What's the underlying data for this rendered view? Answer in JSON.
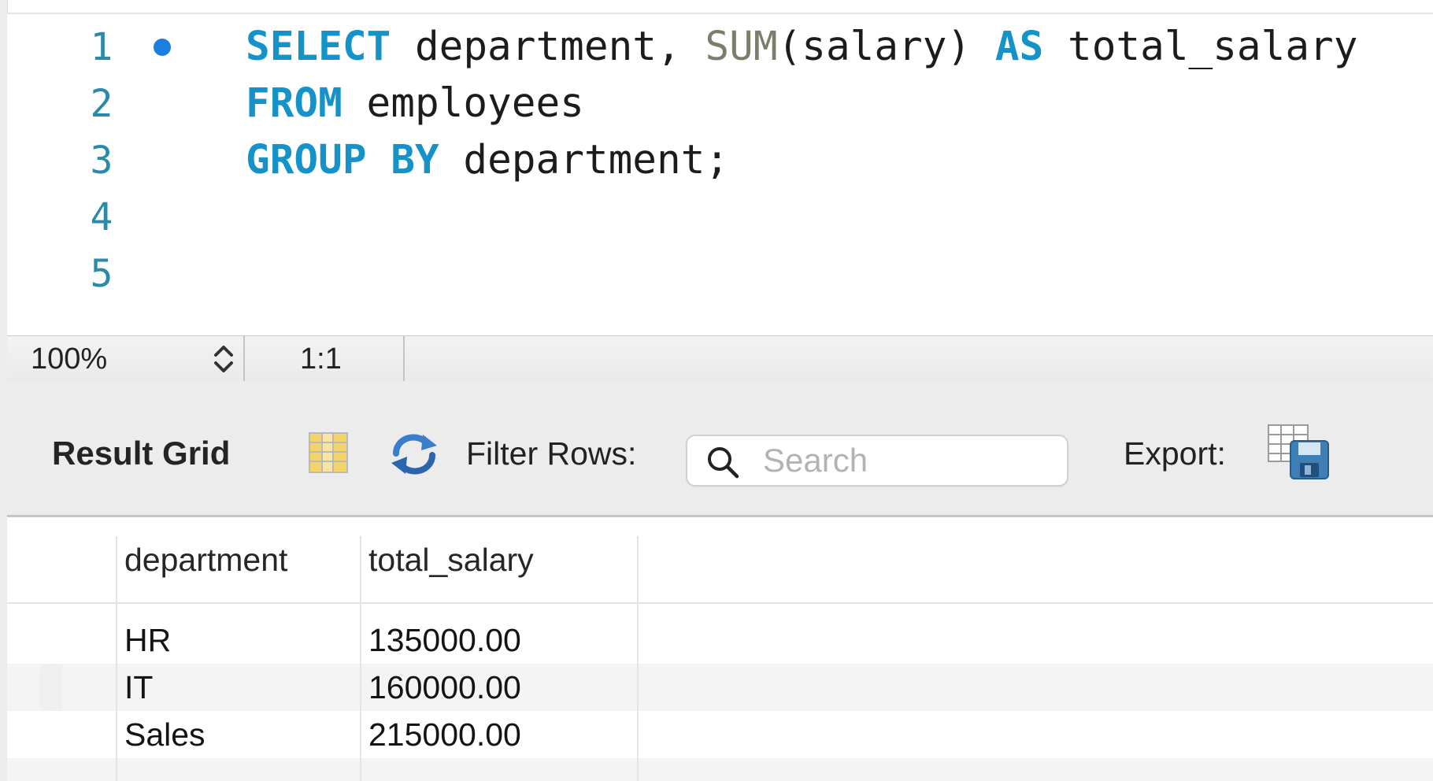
{
  "editor": {
    "lines": [
      {
        "number": "1",
        "has_breakpoint": true
      },
      {
        "number": "2"
      },
      {
        "number": "3"
      },
      {
        "number": "4"
      },
      {
        "number": "5"
      }
    ],
    "code": {
      "line1": {
        "select": "SELECT",
        "part1": " department, ",
        "sum": "SUM",
        "part2": "(salary) ",
        "as": "AS",
        "part3": " total_salary"
      },
      "line2": {
        "from": "FROM",
        "part1": " employees"
      },
      "line3": {
        "group": "GROUP",
        "space": " ",
        "by": "BY",
        "part1": " department;"
      }
    },
    "colors": {
      "keyword": "#1592c8",
      "function": "#7d7d6c",
      "line_number": "#2a8aa7",
      "breakpoint": "#1b7fe0"
    }
  },
  "status_bar": {
    "zoom": "100%",
    "cursor_position": "1:1"
  },
  "result_toolbar": {
    "title": "Result Grid",
    "grid_icon": "result-grid-icon",
    "refresh_icon": "refresh-icon",
    "filter_label": "Filter Rows:",
    "search": {
      "placeholder": "Search",
      "value": ""
    },
    "export_label": "Export:",
    "export_icon": "export-icon"
  },
  "result_grid": {
    "columns": [
      "department",
      "total_salary"
    ],
    "rows": [
      [
        "HR",
        "135000.00"
      ],
      [
        "IT",
        "160000.00"
      ],
      [
        "Sales",
        "215000.00"
      ]
    ]
  }
}
